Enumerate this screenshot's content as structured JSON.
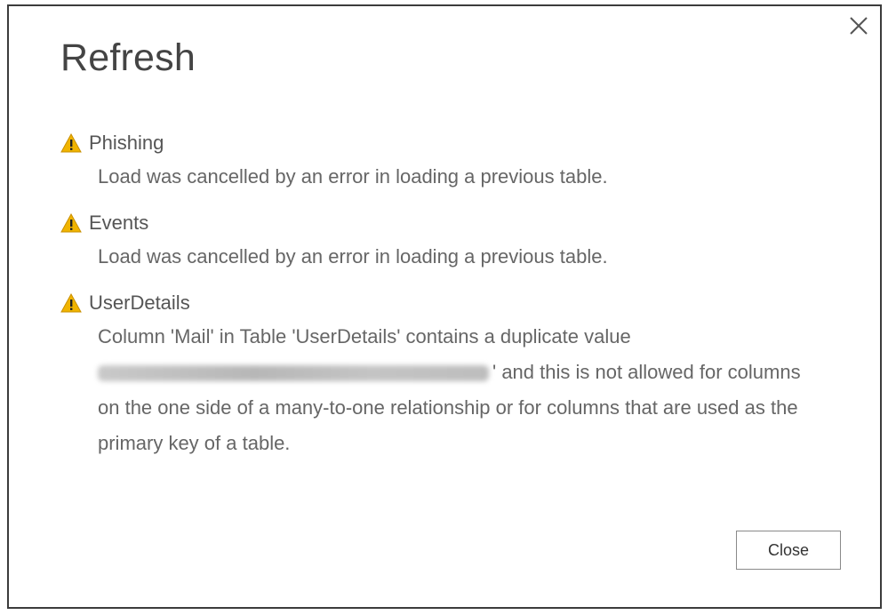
{
  "dialog": {
    "title": "Refresh",
    "close_icon": "close-icon",
    "close_button_label": "Close"
  },
  "messages": [
    {
      "icon": "warning-icon",
      "table": "Phishing",
      "text": "Load was cancelled by an error in loading a previous table."
    },
    {
      "icon": "warning-icon",
      "table": "Events",
      "text": "Load was cancelled by an error in loading a previous table."
    },
    {
      "icon": "warning-icon",
      "table": "UserDetails",
      "text_before": "Column 'Mail' in Table 'UserDetails' contains a duplicate value",
      "text_after": "' and this is not allowed for columns on the one side of a many-to-one relationship or for columns that are used as the primary key of a table."
    }
  ],
  "colors": {
    "warning_fill": "#f0b400",
    "border": "#3c3c3c",
    "button_border": "#8a8a8a"
  }
}
